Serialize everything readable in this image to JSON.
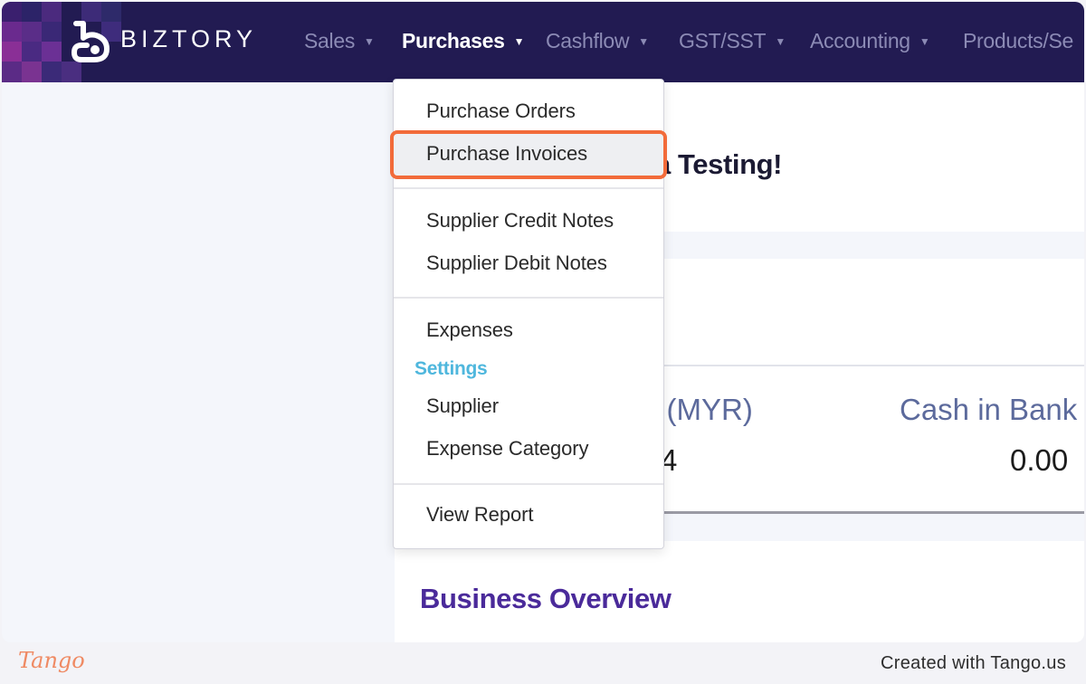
{
  "navbar": {
    "brand": "BIZTORY",
    "items": [
      {
        "label": "Sales"
      },
      {
        "label": "Purchases"
      },
      {
        "label": "Cashflow"
      },
      {
        "label": "GST/SST"
      },
      {
        "label": "Accounting"
      },
      {
        "label": "Products/Se"
      }
    ],
    "active_item": "Purchases"
  },
  "page": {
    "welcome_visible": "a Testing!",
    "stats": [
      {
        "label_visible": "l (MYR)",
        "value_visible": "4"
      },
      {
        "label_visible": "Cash in Bank",
        "value_visible": "0.00"
      }
    ],
    "section_title": "Business Overview"
  },
  "dropdown": {
    "items": [
      {
        "label": "Purchase Orders"
      },
      {
        "label": "Purchase Invoices",
        "highlighted": true
      },
      {
        "label": "Supplier Credit Notes"
      },
      {
        "label": "Supplier Debit Notes"
      },
      {
        "label": "Expenses"
      },
      {
        "label": "Supplier"
      },
      {
        "label": "Expense Category"
      },
      {
        "label": "View Report"
      }
    ],
    "settings_header": "Settings"
  },
  "footer": {
    "logo_text": "Tango",
    "credit": "Created with Tango.us"
  },
  "colors": {
    "navbar_bg": "#221b52",
    "highlight_border": "#f26b3a",
    "settings_header": "#4fb7dd",
    "section_title": "#4a2a9a"
  }
}
